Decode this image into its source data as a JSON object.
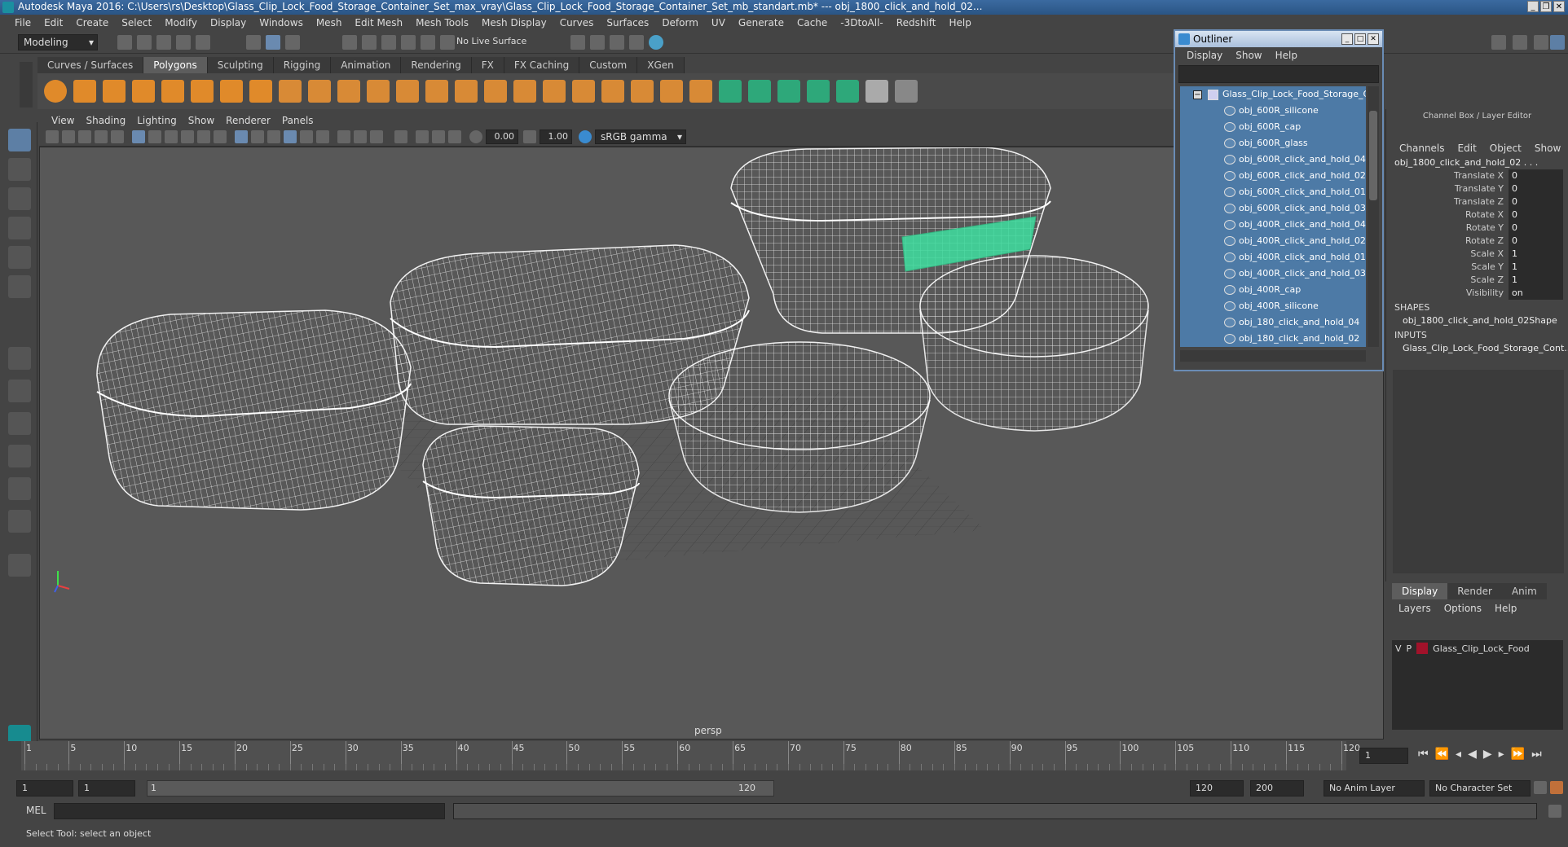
{
  "title": "Autodesk Maya 2016: C:\\Users\\rs\\Desktop\\Glass_Clip_Lock_Food_Storage_Container_Set_max_vray\\Glass_Clip_Lock_Food_Storage_Container_Set_mb_standart.mb*  ---  obj_1800_click_and_hold_02...",
  "menu": [
    "File",
    "Edit",
    "Create",
    "Select",
    "Modify",
    "Display",
    "Windows",
    "Mesh",
    "Edit Mesh",
    "Mesh Tools",
    "Mesh Display",
    "Curves",
    "Surfaces",
    "Deform",
    "UV",
    "Generate",
    "Cache",
    "-3DtoAll-",
    "Redshift",
    "Help"
  ],
  "status": {
    "mode": "Modeling",
    "live_surface": "No Live Surface"
  },
  "shelf_tabs": [
    "Curves / Surfaces",
    "Polygons",
    "Sculpting",
    "Rigging",
    "Animation",
    "Rendering",
    "FX",
    "FX Caching",
    "Custom",
    "XGen"
  ],
  "shelf_active": "Polygons",
  "viewport": {
    "menu": [
      "View",
      "Shading",
      "Lighting",
      "Show",
      "Renderer",
      "Panels"
    ],
    "field_a": "0.00",
    "field_b": "1.00",
    "color_space": "sRGB gamma",
    "camera": "persp"
  },
  "outliner": {
    "title": "Outliner",
    "menu": [
      "Display",
      "Show",
      "Help"
    ],
    "root": "Glass_Clip_Lock_Food_Storage_C",
    "items": [
      "obj_600R_silicone",
      "obj_600R_cap",
      "obj_600R_glass",
      "obj_600R_click_and_hold_04",
      "obj_600R_click_and_hold_02",
      "obj_600R_click_and_hold_01",
      "obj_600R_click_and_hold_03",
      "obj_400R_click_and_hold_04",
      "obj_400R_click_and_hold_02",
      "obj_400R_click_and_hold_01",
      "obj_400R_click_and_hold_03",
      "obj_400R_cap",
      "obj_400R_silicone",
      "obj_180_click_and_hold_04",
      "obj_180_click_and_hold_02"
    ]
  },
  "channel_box": {
    "header": "Channel Box / Layer Editor",
    "menu": [
      "Channels",
      "Edit",
      "Object",
      "Show"
    ],
    "object": "obj_1800_click_and_hold_02 . . .",
    "attributes": [
      {
        "name": "Translate X",
        "value": "0"
      },
      {
        "name": "Translate Y",
        "value": "0"
      },
      {
        "name": "Translate Z",
        "value": "0"
      },
      {
        "name": "Rotate X",
        "value": "0"
      },
      {
        "name": "Rotate Y",
        "value": "0"
      },
      {
        "name": "Rotate Z",
        "value": "0"
      },
      {
        "name": "Scale X",
        "value": "1"
      },
      {
        "name": "Scale Y",
        "value": "1"
      },
      {
        "name": "Scale Z",
        "value": "1"
      },
      {
        "name": "Visibility",
        "value": "on"
      }
    ],
    "shapes_label": "SHAPES",
    "shape": "obj_1800_click_and_hold_02Shape",
    "inputs_label": "INPUTS",
    "input": "Glass_Clip_Lock_Food_Storage_Cont..."
  },
  "layer_editor": {
    "tabs": [
      "Display",
      "Render",
      "Anim"
    ],
    "active_tab": "Display",
    "menu": [
      "Layers",
      "Options",
      "Help"
    ],
    "layer": {
      "v": "V",
      "p": "P",
      "name": "Glass_Clip_Lock_Food",
      "color": "#a1122a"
    }
  },
  "timeline": {
    "ticks": [
      "1",
      "5",
      "10",
      "15",
      "20",
      "25",
      "30",
      "35",
      "40",
      "45",
      "50",
      "55",
      "60",
      "65",
      "70",
      "75",
      "80",
      "85",
      "90",
      "95",
      "100",
      "105",
      "110",
      "115",
      "120"
    ],
    "current_frame": "1"
  },
  "range": {
    "start": "1",
    "start2": "1",
    "slider_start": "1",
    "slider_end": "120",
    "end": "120",
    "end2": "200",
    "anim_layer": "No Anim Layer",
    "char_set": "No Character Set"
  },
  "command_line": {
    "label": "MEL"
  },
  "help_line": "Select Tool: select an object",
  "colors": {
    "highlight": "#3fe0a0",
    "outliner_bg": "#4d7aa6"
  }
}
